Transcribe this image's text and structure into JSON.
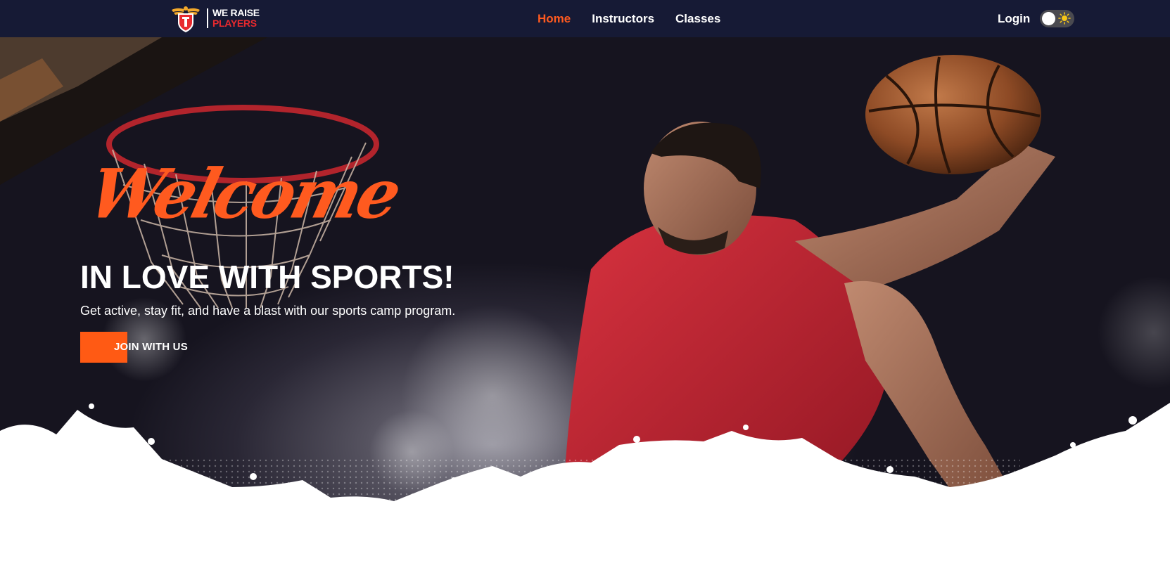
{
  "brand": {
    "line1": "WE RAISE",
    "line2": "PLAYERS"
  },
  "nav": {
    "links": [
      {
        "label": "Home",
        "active": true
      },
      {
        "label": "Instructors",
        "active": false
      },
      {
        "label": "Classes",
        "active": false
      }
    ],
    "login_label": "Login",
    "theme_toggle_icon": "sun-icon"
  },
  "hero": {
    "script_heading": "Welcome",
    "title": "IN LOVE WITH SPORTS!",
    "subtitle": "Get active, stay fit, and have a blast with our sports camp program.",
    "cta_label": "JOIN WITH US"
  },
  "colors": {
    "navbar_bg": "#161a35",
    "accent": "#ff5a1f",
    "brand_red": "#e8292e",
    "text_on_dark": "#ffffff"
  }
}
